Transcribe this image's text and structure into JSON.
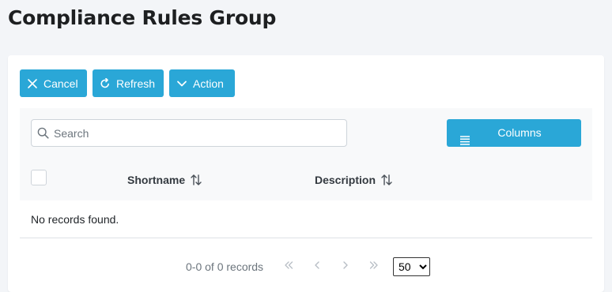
{
  "page": {
    "title": "Compliance Rules Group"
  },
  "toolbar": {
    "cancel_label": "Cancel",
    "refresh_label": "Refresh",
    "action_label": "Action"
  },
  "search": {
    "placeholder": "Search",
    "value": ""
  },
  "columns_button": {
    "label": "Columns"
  },
  "table": {
    "headers": [
      {
        "label": "Shortname",
        "sortable": true
      },
      {
        "label": "Description",
        "sortable": true
      }
    ],
    "rows": [],
    "empty_message": "No records found."
  },
  "paginator": {
    "records_info": "0-0 of 0 records",
    "page_size": "50",
    "page_size_options": [
      "50"
    ]
  },
  "icons": {
    "cancel": "close-icon",
    "refresh": "refresh-icon",
    "action": "chevron-down-icon",
    "search": "search-icon",
    "columns": "list-icon",
    "sort": "sort-icon"
  },
  "colors": {
    "accent": "#2aa7d7",
    "background": "#f3f5f8",
    "panel_header": "#f8f9fa"
  }
}
